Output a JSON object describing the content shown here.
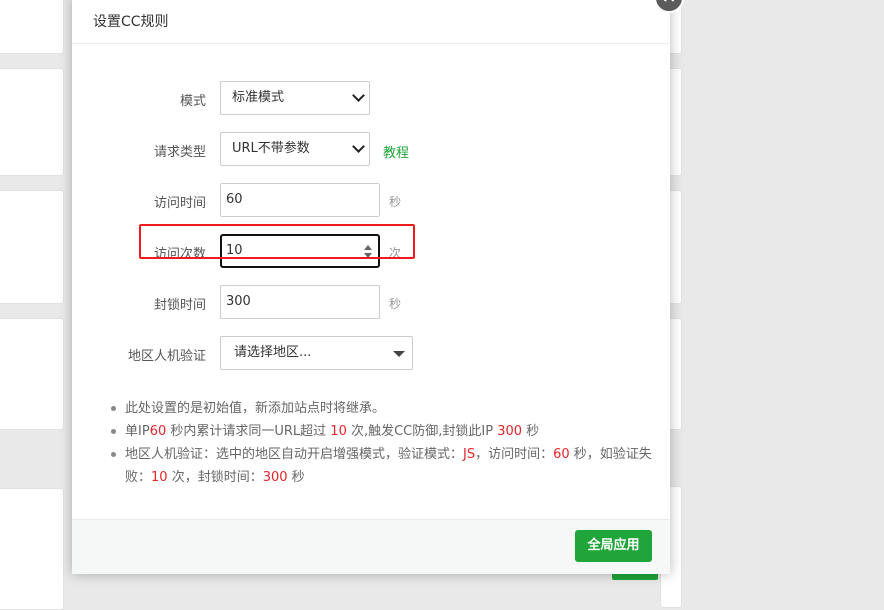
{
  "dialog": {
    "title": "设置CC规则",
    "close_symbol": "×"
  },
  "form": {
    "mode": {
      "label": "模式",
      "value": "标准模式"
    },
    "request_type": {
      "label": "请求类型",
      "value": "URL不带参数",
      "help_link": "教程"
    },
    "visit_time": {
      "label": "访问时间",
      "value": "60",
      "unit": "秒"
    },
    "visit_count": {
      "label": "访问次数",
      "value": "10",
      "unit": "次"
    },
    "block_time": {
      "label": "封锁时间",
      "value": "300",
      "unit": "秒"
    },
    "region_verify": {
      "label": "地区人机验证",
      "placeholder": "请选择地区..."
    }
  },
  "notes": {
    "n1": "此处设置的是初始值，新添加站点时将继承。",
    "n2": {
      "p1": "单IP",
      "v1": "60",
      "p2": " 秒内累计请求同一URL超过 ",
      "v2": "10",
      "p3": " 次,触发CC防御,封锁此IP ",
      "v3": "300",
      "p4": " 秒"
    },
    "n3": {
      "p1": "地区人机验证：选中的地区自动开启增强模式，验证模式：",
      "v1": "JS",
      "p2": "，访问时间：",
      "v2": "60",
      "p3": " 秒，如验证失败：",
      "v3": "10",
      "p4": " 次，封锁时间：",
      "v4": "300",
      "p5": " 秒"
    }
  },
  "footer": {
    "apply_label": "全局应用"
  },
  "colors": {
    "accent": "#20a53a",
    "highlight": "#ee1c1c",
    "emphasis": "#e3262a"
  }
}
